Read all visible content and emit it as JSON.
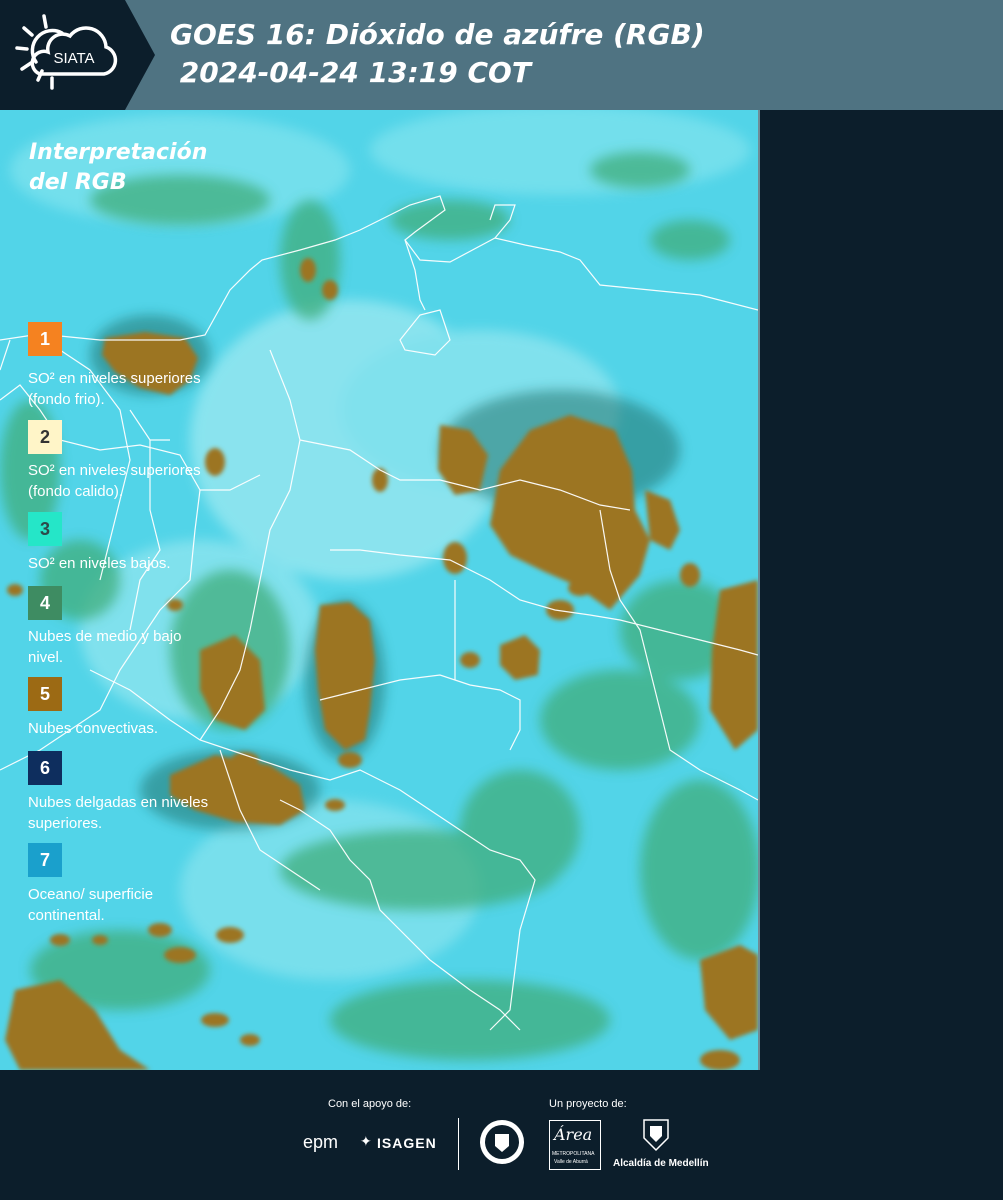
{
  "header": {
    "logo_text": "SIATA",
    "title": "GOES 16: Dióxido de azúfre (RGB)\n 2024-04-24 13:19 COT"
  },
  "legend": {
    "title": "Interpretación del RGB",
    "items": [
      {
        "number": "1",
        "color": "#f58220",
        "text": "SO² en niveles superiores (fondo frio)."
      },
      {
        "number": "2",
        "color": "#fff5c8",
        "text": "SO² en niveles superiores (fondo calido)."
      },
      {
        "number": "3",
        "color": "#25e6c8",
        "text": "SO² en niveles bajos."
      },
      {
        "number": "4",
        "color": "#3e8c62",
        "text": "Nubes de medio y bajo nivel."
      },
      {
        "number": "5",
        "color": "#9c6a14",
        "text": "Nubes convectivas."
      },
      {
        "number": "6",
        "color": "#0e2e5e",
        "text": "Nubes delgadas en niveles superiores."
      },
      {
        "number": "7",
        "color": "#1aa0cc",
        "text": "Oceano/ superficie continental."
      }
    ]
  },
  "footer": {
    "support_label": "Con el apoyo de:",
    "project_label": "Un proyecto de:",
    "brand_epm": "epm",
    "brand_isagen": "ISAGEN",
    "brand_area": "Área",
    "brand_area_sub": "METROPOLITANA",
    "brand_area_sub2": "Valle de Aburrá",
    "brand_alcaldia": "Alcaldía de Medellín"
  },
  "map": {
    "colors": {
      "background": "#52d4e8",
      "convective": "#9c7420",
      "low_cloud": "#3fae7c",
      "border": "#ffffff"
    }
  }
}
